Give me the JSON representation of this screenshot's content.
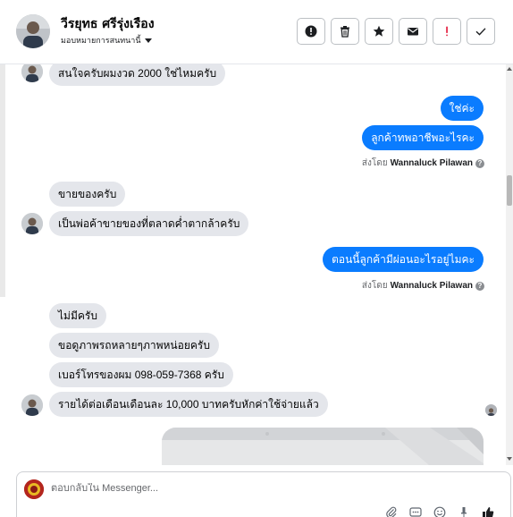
{
  "header": {
    "contact_name": "วีรยุทธ ศรีรุ่งเรือง",
    "assign_label": "มอบหมายการสนทนานี้",
    "actions": [
      {
        "name": "spam-button",
        "icon": "alert-circle-icon"
      },
      {
        "name": "delete-button",
        "icon": "trash-icon"
      },
      {
        "name": "star-button",
        "icon": "star-icon"
      },
      {
        "name": "mark-unread-button",
        "icon": "envelope-icon"
      },
      {
        "name": "follow-up-button",
        "icon": "exclamation-icon"
      },
      {
        "name": "mark-done-button",
        "icon": "check-icon"
      }
    ]
  },
  "thread": {
    "messages": [
      {
        "id": "m1",
        "dir": "in",
        "text": "สนใจครับผมงวด 2000 ใช่ไหมครับ"
      },
      {
        "id": "m2",
        "dir": "out",
        "text": "ใช่ค่ะ"
      },
      {
        "id": "m3",
        "dir": "out",
        "text": "ลูกค้าทพอาชีพอะไรคะ"
      },
      {
        "id": "m4",
        "dir": "in",
        "text": "ขายของครับ"
      },
      {
        "id": "m5",
        "dir": "in",
        "text": "เป็นพ่อค้าขายของที่ตลาดค่ำตากล้าครับ"
      },
      {
        "id": "m6",
        "dir": "out",
        "text": "ตอนนี้ลูกค้ามีผ่อนอะไรอยู่ไมคะ"
      },
      {
        "id": "m7",
        "dir": "in",
        "text": "ไม่มีครับ"
      },
      {
        "id": "m8",
        "dir": "in",
        "text": "ขอดูภาพรถหลายๆภาพหน่อยครับ"
      },
      {
        "id": "m9",
        "dir": "in",
        "text": "เบอร์โทรของผม 098-059-7368 ครับ"
      },
      {
        "id": "m10",
        "dir": "in",
        "text": "รายได้ต่อเดือนเดือนละ 10,000 บาทครับหักค่าใช้จ่ายแล้ว"
      }
    ],
    "sent_by_label": "ส่งโดย",
    "sent_by_name": "Wannaluck Pilawan"
  },
  "composer": {
    "placeholder": "ตอบกลับใน Messenger...",
    "tools": [
      "attachment-icon",
      "saved-replies-icon",
      "emoji-icon",
      "pin-icon",
      "like-icon"
    ]
  },
  "colors": {
    "outgoing_bubble": "#0a7cff",
    "incoming_bubble": "#e4e6eb",
    "follow_up_red": "#e41e3f"
  }
}
